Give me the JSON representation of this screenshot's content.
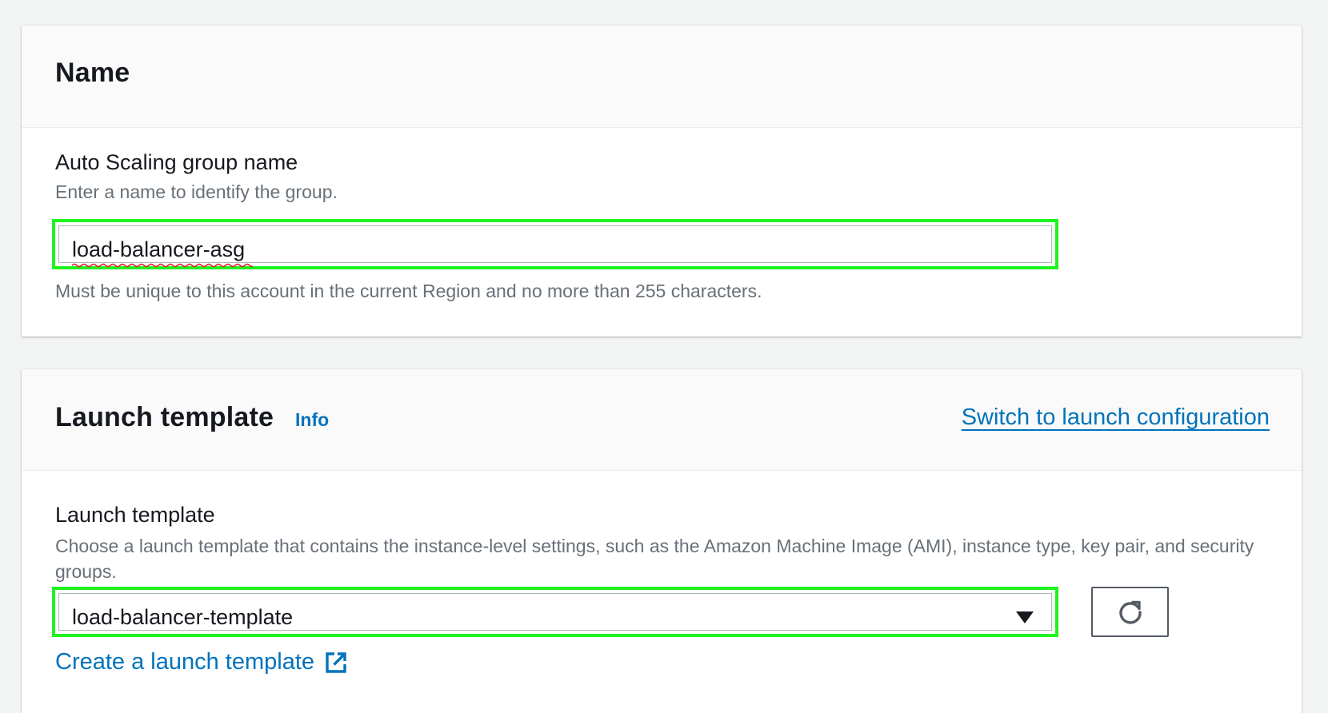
{
  "name_panel": {
    "title": "Name",
    "field_label": "Auto Scaling group name",
    "field_description": "Enter a name to identify the group.",
    "input_value": "load-balancer-asg",
    "field_hint": "Must be unique to this account in the current Region and no more than 255 characters."
  },
  "launch_panel": {
    "title": "Launch template",
    "info_label": "Info",
    "switch_link": "Switch to launch configuration",
    "field_label": "Launch template",
    "field_description": "Choose a launch template that contains the instance-level settings, such as the Amazon Machine Image (AMI), instance type, key pair, and security groups.",
    "select_value": "load-balancer-template",
    "create_link": "Create a launch template"
  },
  "icons": {
    "dropdown": "caret-down-icon",
    "refresh": "refresh-icon",
    "external": "external-link-icon"
  },
  "colors": {
    "link": "#0073bb",
    "highlight": "#1ff31f",
    "text": "#16191f",
    "secondary_text": "#687078"
  }
}
